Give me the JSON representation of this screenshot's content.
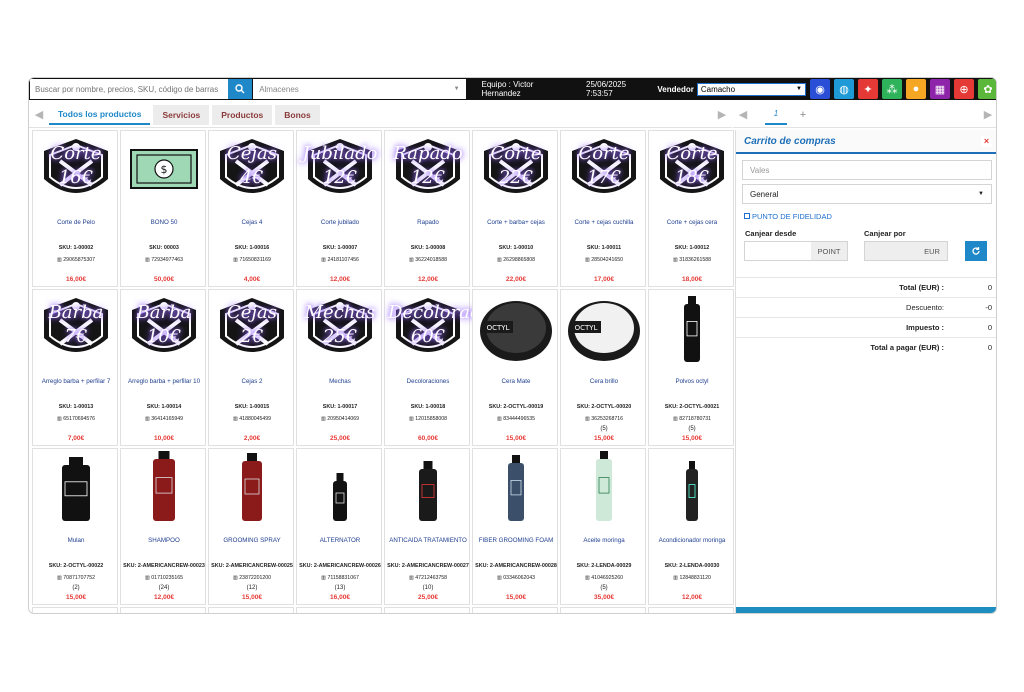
{
  "topbar": {
    "search_placeholder": "Buscar por nombre, precios, SKU, código de barras",
    "store_placeholder": "Almacenes",
    "team": "Equipo : Victor Hernandez",
    "datetime": "25/06/2025 7:53:57",
    "vendor_label": "Vendedor",
    "vendor_value": "Camacho",
    "tools": [
      {
        "icon": "circle-badge-icon",
        "color": "#2a4fd6"
      },
      {
        "icon": "globe-icon",
        "color": "#1e9bd6"
      },
      {
        "icon": "tag-icon",
        "color": "#e53935"
      },
      {
        "icon": "users-grid-icon",
        "color": "#2eb35a"
      },
      {
        "icon": "person-icon",
        "color": "#f5a623"
      },
      {
        "icon": "grid-icon",
        "color": "#8e24aa"
      },
      {
        "icon": "plus-circle-icon",
        "color": "#e53935"
      },
      {
        "icon": "gear-icon",
        "color": "#5bb83a"
      }
    ]
  },
  "tabs": [
    "Todos los productos",
    "Servicios",
    "Productos",
    "Bonos"
  ],
  "products": [
    {
      "type": "promo",
      "l1": "Corte",
      "l2": "16€",
      "name": "Corte de Pelo",
      "sku": "SKU: 1-00002",
      "barcode": "29065875307",
      "qty": "",
      "price": "16,00€"
    },
    {
      "type": "bono",
      "name": "BONO 50",
      "sku": "SKU: 00003",
      "barcode": "72934977463",
      "qty": "",
      "price": "50,00€"
    },
    {
      "type": "promo",
      "l1": "Cejas",
      "l2": "4€",
      "name": "Cejas 4",
      "sku": "SKU: 1-00016",
      "barcode": "71650831169",
      "qty": "",
      "price": "4,00€"
    },
    {
      "type": "promo",
      "l1": "Jubilado",
      "l2": "12€",
      "name": "Corte jubilado",
      "sku": "SKU: 1-00007",
      "barcode": "24181107456",
      "qty": "",
      "price": "12,00€"
    },
    {
      "type": "promo",
      "l1": "Rapado",
      "l2": "12€",
      "name": "Rapado",
      "sku": "SKU: 1-00008",
      "barcode": "36224018588",
      "qty": "",
      "price": "12,00€"
    },
    {
      "type": "promo",
      "l1": "Corte",
      "l2": "22€",
      "name": "Corte + barba+ cejas",
      "sku": "SKU: 1-00010",
      "barcode": "26298865808",
      "qty": "",
      "price": "22,00€"
    },
    {
      "type": "promo",
      "l1": "Corte",
      "l2": "17€",
      "name": "Corte + cejas cuchilla",
      "sku": "SKU: 1-00011",
      "barcode": "28504241650",
      "qty": "",
      "price": "17,00€"
    },
    {
      "type": "promo",
      "l1": "Corte",
      "l2": "18€",
      "name": "Corte + cejas cera",
      "sku": "SKU: 1-00012",
      "barcode": "31836261588",
      "qty": "",
      "price": "18,00€"
    },
    {
      "type": "promo",
      "l1": "Barba",
      "l2": "7€",
      "name": "Arreglo barba + perfilar 7",
      "sku": "SKU: 1-00013",
      "barcode": "65170694576",
      "qty": "",
      "price": "7,00€"
    },
    {
      "type": "promo",
      "l1": "Barba",
      "l2": "10€",
      "name": "Arreglo barba + perfilar 10",
      "sku": "SKU: 1-00014",
      "barcode": "36414165949",
      "qty": "",
      "price": "10,00€"
    },
    {
      "type": "promo",
      "l1": "Cejas",
      "l2": "2€",
      "name": "Cejas 2",
      "sku": "SKU: 1-00015",
      "barcode": "41880045499",
      "qty": "",
      "price": "2,00€"
    },
    {
      "type": "promo",
      "l1": "Mechas",
      "l2": "25€",
      "name": "Mechas",
      "sku": "SKU: 1-00017",
      "barcode": "20950414069",
      "qty": "",
      "price": "25,00€"
    },
    {
      "type": "promo",
      "l1": "Decoloración",
      "l2": "60€",
      "name": "Decoloraciones",
      "sku": "SKU: 1-00018",
      "barcode": "12015858008",
      "qty": "",
      "price": "60,00€"
    },
    {
      "type": "jar",
      "jar": "dark",
      "name": "Cera Mate",
      "sku": "SKU: 2-OCTYL-00019",
      "barcode": "83444496535",
      "qty": "",
      "price": "15,00€"
    },
    {
      "type": "jar",
      "jar": "light",
      "name": "Cera brillo",
      "sku": "SKU: 2-OCTYL-00020",
      "barcode": "36253268716",
      "qty": "(5)",
      "price": "15,00€"
    },
    {
      "type": "bottle",
      "bottle": "powder",
      "name": "Polvos octyl",
      "sku": "SKU: 2-OCTYL-00021",
      "barcode": "82718780731",
      "qty": "(5)",
      "price": "15,00€"
    },
    {
      "type": "bottle",
      "bottle": "black-wide",
      "name": "Mulan",
      "sku": "SKU: 2-OCTYL-00022",
      "barcode": "70871707752",
      "qty": "(2)",
      "price": "15,00€"
    },
    {
      "type": "bottle",
      "bottle": "red",
      "name": "SHAMPOO",
      "sku": "SKU: 2-AMERICANCREW-00023",
      "barcode": "01710235165",
      "qty": "(24)",
      "price": "12,00€"
    },
    {
      "type": "bottle",
      "bottle": "red-spray",
      "name": "GROOMING SPRAY",
      "sku": "SKU: 2-AMERICANCREW-00025",
      "barcode": "23872201200",
      "qty": "(12)",
      "price": "15,00€"
    },
    {
      "type": "bottle",
      "bottle": "small-black",
      "name": "ALTERNATOR",
      "sku": "SKU: 2-AMERICANCREW-00026",
      "barcode": "71158831067",
      "qty": "(13)",
      "price": "16,00€"
    },
    {
      "type": "bottle",
      "bottle": "dropper",
      "name": "ANTICAIDA TRATAMIENTO",
      "sku": "SKU: 2-AMERICANCREW-00027",
      "barcode": "47212463758",
      "qty": "(10)",
      "price": "25,00€"
    },
    {
      "type": "bottle",
      "bottle": "blue",
      "name": "FIBER GROOMING FOAM",
      "sku": "SKU: 2-AMERICANCREW-00028",
      "barcode": "03346062043",
      "qty": "",
      "price": "15,00€"
    },
    {
      "type": "bottle",
      "bottle": "oil",
      "name": "Aceite moringa",
      "sku": "SKU: 2-LENDA-00029",
      "barcode": "41046925260",
      "qty": "(5)",
      "price": "35,00€"
    },
    {
      "type": "bottle",
      "bottle": "conditioner",
      "name": "Acondicionador moringa",
      "sku": "SKU: 2-LENDA-00030",
      "barcode": "12848831120",
      "qty": "",
      "price": "12,00€"
    }
  ],
  "right": {
    "tab_num": "1",
    "tab_add": "+",
    "cart_title": "Carrito de compras",
    "close": "×",
    "vales_placeholder": "Vales",
    "general": "General",
    "fidelity": "PUNTO DE FIDELIDAD",
    "canjear_desde": "Canjear desde",
    "canjear_por": "Canjear por",
    "point_unit": "POINT",
    "eur_unit": "EUR",
    "totals": [
      {
        "k": "Total (EUR) :",
        "v": "0",
        "bold": true
      },
      {
        "k": "Descuento:",
        "v": "-0",
        "bold": false
      },
      {
        "k": "Impuesto :",
        "v": "0",
        "bold": true
      },
      {
        "k": "Total a pagar (EUR) :",
        "v": "0",
        "bold": true
      }
    ]
  }
}
